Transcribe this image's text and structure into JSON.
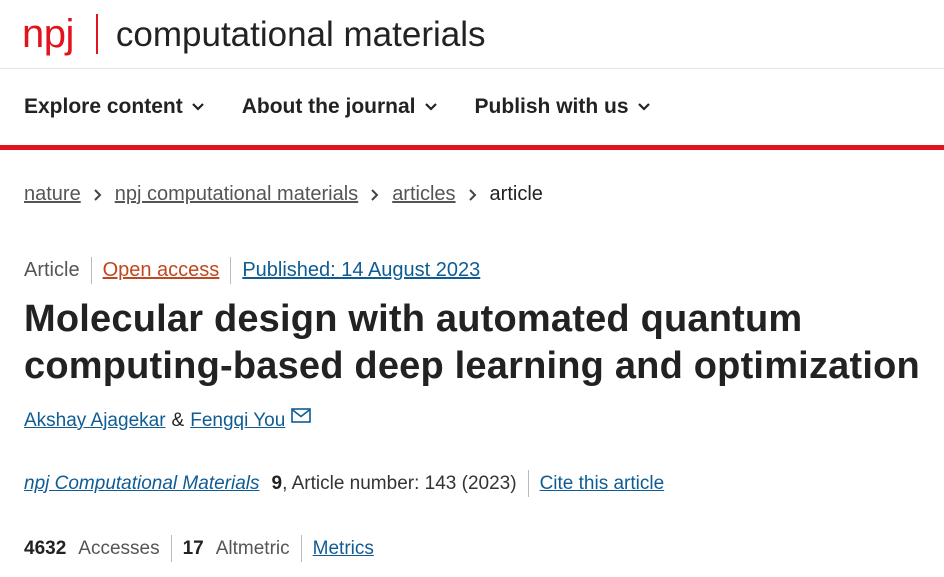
{
  "logo": {
    "brand": "npj",
    "journal_title": "computational materials"
  },
  "nav": {
    "items": [
      {
        "label": "Explore content"
      },
      {
        "label": "About the journal"
      },
      {
        "label": "Publish with us"
      }
    ]
  },
  "breadcrumb": [
    "nature",
    "npj computational materials",
    "articles",
    "article"
  ],
  "article": {
    "type": "Article",
    "access": "Open access",
    "published": "Published: 14 August 2023",
    "title_line1": "Molecular design with automated quantum",
    "title_line2": "computing-based deep learning and optimization",
    "authors": [
      "Akshay Ajagekar",
      "Fengqi You"
    ],
    "author_joiner": "&",
    "journal": "npj Computational Materials",
    "volume": "9",
    "article_number": ", Article number: 143 (2023)",
    "cite": "Cite this article"
  },
  "metrics": {
    "accesses_count": "4632",
    "accesses_label": "Accesses",
    "altmetric_count": "17",
    "altmetric_label": "Altmetric",
    "link": "Metrics"
  },
  "colors": {
    "brand_red": "#e1141e",
    "link_blue": "#0f5c94",
    "open_access_orange": "#c0471f"
  },
  "icons": {
    "nav_dropdown": "chevron-down-icon",
    "corresponding_author": "mail-icon",
    "breadcrumb_separator": "chevron-right-icon"
  }
}
